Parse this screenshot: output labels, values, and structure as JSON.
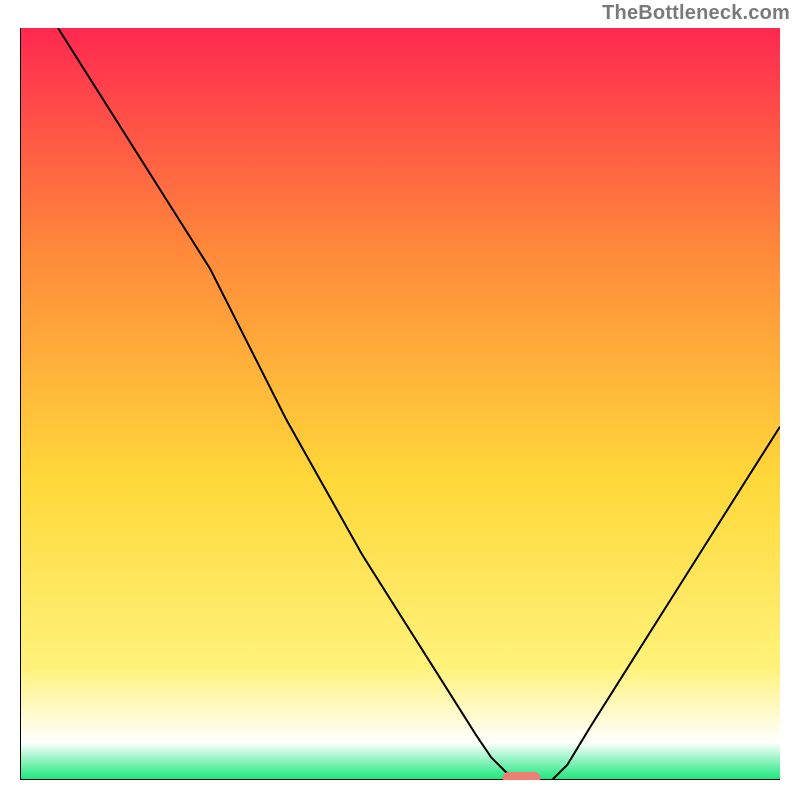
{
  "watermark": "TheBottleneck.com",
  "chart_data": {
    "type": "line",
    "title": "",
    "xlabel": "",
    "ylabel": "",
    "xlim": [
      0,
      100
    ],
    "ylim": [
      0,
      100
    ],
    "grid": false,
    "legend": false,
    "background_gradient": {
      "top": "#ff2850",
      "mid_upper": "#ff8a3a",
      "mid": "#ffd83a",
      "mid_lower": "#fff27a",
      "lower": "#ffffff",
      "bottom": "#17e87a"
    },
    "series": [
      {
        "name": "curve",
        "x": [
          5.0,
          10,
          15,
          20,
          25,
          30,
          35,
          40,
          45,
          50,
          55,
          60,
          62,
          64,
          66,
          70,
          72,
          75,
          80,
          85,
          90,
          95,
          100
        ],
        "y": [
          100,
          92,
          84,
          76,
          68,
          58,
          48,
          39,
          30,
          22,
          14,
          6,
          3,
          1,
          0,
          0,
          2,
          7,
          15,
          23,
          31,
          39,
          47
        ]
      }
    ],
    "annotations": [
      {
        "name": "marker-pill",
        "x": 66,
        "y": 0,
        "shape": "pill",
        "color": "#ee7f74"
      }
    ]
  }
}
